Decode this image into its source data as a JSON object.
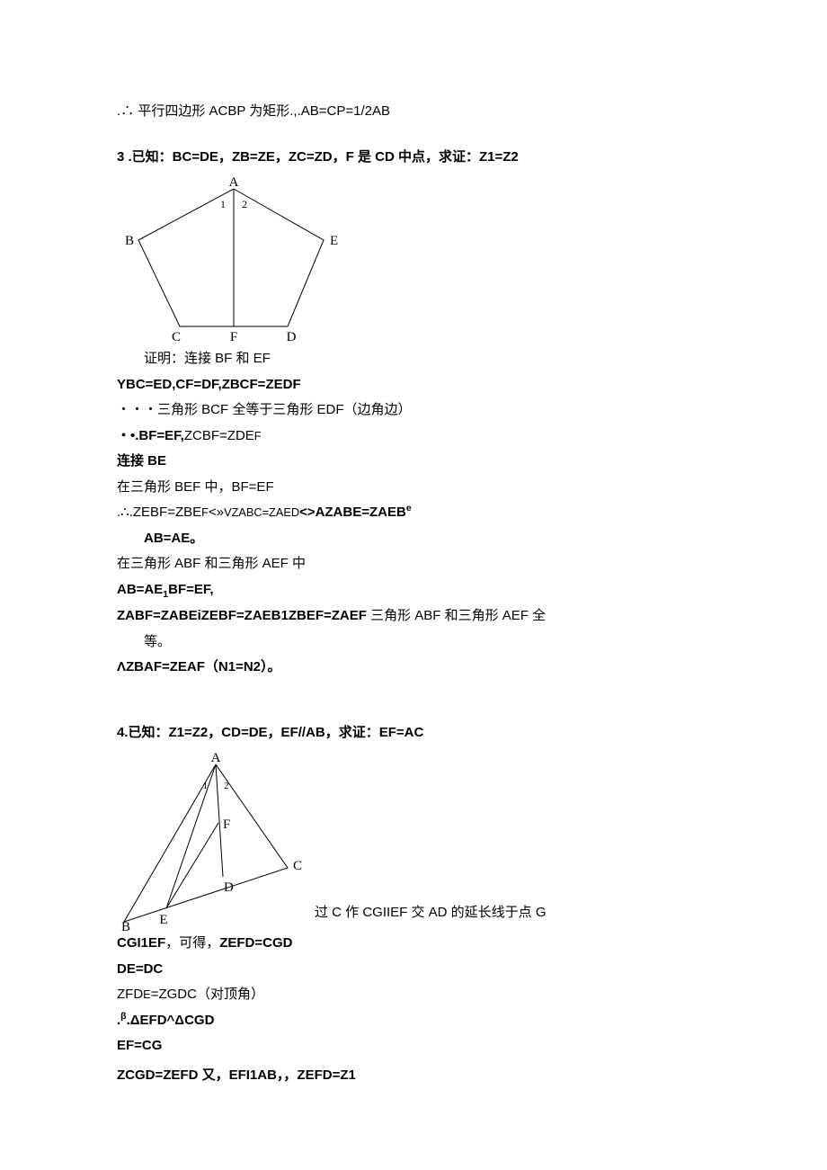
{
  "line_01": ".∴ 平行四边形 ACBP 为矩形.,.AB=CP=1/2AB",
  "line_02a": "3",
  "line_02b": " .已知：BC=DE，ZB=ZE，ZC=ZD，F 是 CD 中点，求证：Z1=Z2",
  "line_03": "证明：连接 BF 和 EF",
  "line_04": "YBC=ED,CF=DF,ZBCF=ZEDF",
  "line_05": "・・・三角形 BCF 全等于三角形 EDF（边角边）",
  "line_06_a": "・•.BF=EF,",
  "line_06_b": "ZCBF=ZDE",
  "line_06_c": "F",
  "line_07": "连接 BE",
  "line_08": "在三角形 BEF 中，BF=EF",
  "line_09_a": ".∴.ZEBF=ZBE",
  "line_09_b": "F",
  "line_09_c": "<»",
  "line_09_d": "V",
  "line_09_e": "ZABC=ZAED",
  "line_09_f": "<>AZABE=ZAEB",
  "line_09_g": "e",
  "line_10": "AB=AE。",
  "line_11": "在三角形 ABF 和三角形 AEF 中",
  "line_12_a": "AB=AE",
  "line_12_b": "1",
  "line_12_c": "BF=EF,",
  "line_13_pref": "ZABF=ZABEiZEBF=ZAEB1ZBEF=ZAEF",
  "line_13_suf": " 三角形 ABF 和三角形 AEF 全",
  "line_13b": "等。",
  "line_14": "ΛZBAF=ZEAF（N1=N2）。",
  "line_15": "4.已知：Z1=Z2，CD=DE，EF//AB，求证：EF=AC",
  "line_16": "过 C 作 CGIIEF 交 AD 的延长线于点 G",
  "line_17_a": "CGI1EF",
  "line_17_b": "，可得，",
  "line_17_c": "ZEFD=CGD",
  "line_18": "DE=DC",
  "line_19_a": "ZFD",
  "line_19_b": "E",
  "line_19_c": "=ZGDC（对顶角）",
  "line_20_a": ".",
  "line_20_b": "β",
  "line_20_c": ".ΔEFD^ΔCGD",
  "line_21": "EF=CG",
  "line_22": "ZCGD=ZEFD 又，EFI1AB，，ZEFD=Z1",
  "labels_fig1": {
    "A": "A",
    "B": "B",
    "E": "E",
    "C": "C",
    "D": "D",
    "F": "F",
    "one": "1",
    "two": "2"
  },
  "labels_fig2": {
    "A": "A",
    "B": "B",
    "C": "C",
    "D": "D",
    "E": "E",
    "F": "F",
    "one": "1",
    "two": "2"
  }
}
